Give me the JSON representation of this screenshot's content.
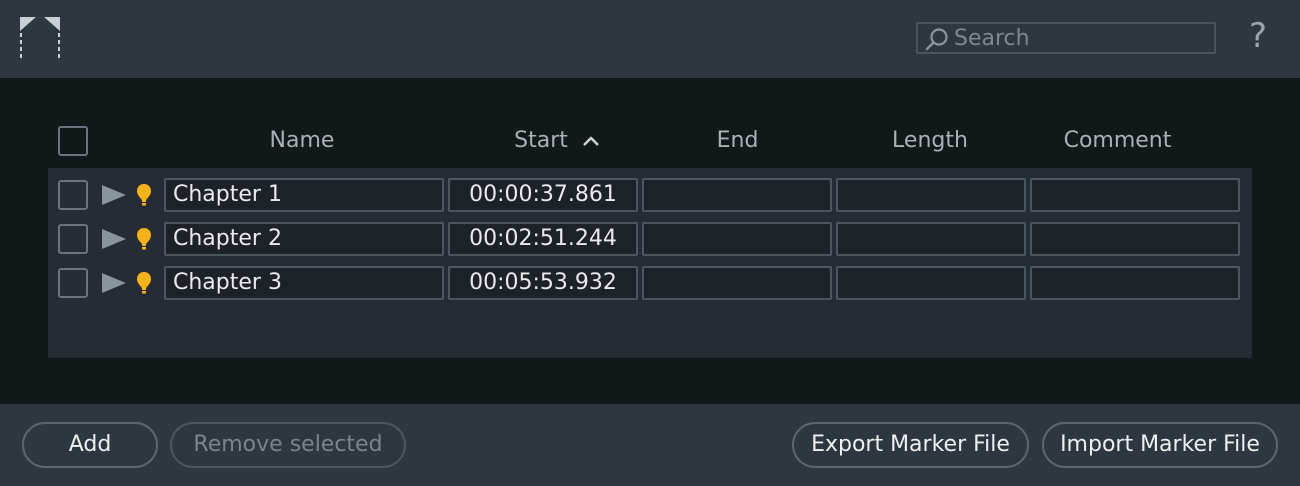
{
  "header": {
    "search_placeholder": "Search",
    "help_label": "?"
  },
  "table": {
    "columns": [
      "Name",
      "Start",
      "End",
      "Length",
      "Comment"
    ],
    "sort": {
      "column": "Start",
      "direction": "ascending"
    },
    "rows": [
      {
        "name": "Chapter 1",
        "start": "00:00:37.861",
        "end": "",
        "length": "",
        "comment": "",
        "checked": false
      },
      {
        "name": "Chapter 2",
        "start": "00:02:51.244",
        "end": "",
        "length": "",
        "comment": "",
        "checked": false
      },
      {
        "name": "Chapter 3",
        "start": "00:05:53.932",
        "end": "",
        "length": "",
        "comment": "",
        "checked": false
      }
    ]
  },
  "footer": {
    "add_label": "Add",
    "remove_label": "Remove selected",
    "export_label": "Export Marker File",
    "import_label": "Import Marker File"
  },
  "colors": {
    "marker": "#f5b21a",
    "panel": "#2e3740",
    "background": "#121719"
  },
  "icons": [
    "logo-icon",
    "search-icon",
    "help-icon",
    "sort-up-icon",
    "play-icon",
    "marker-icon"
  ]
}
